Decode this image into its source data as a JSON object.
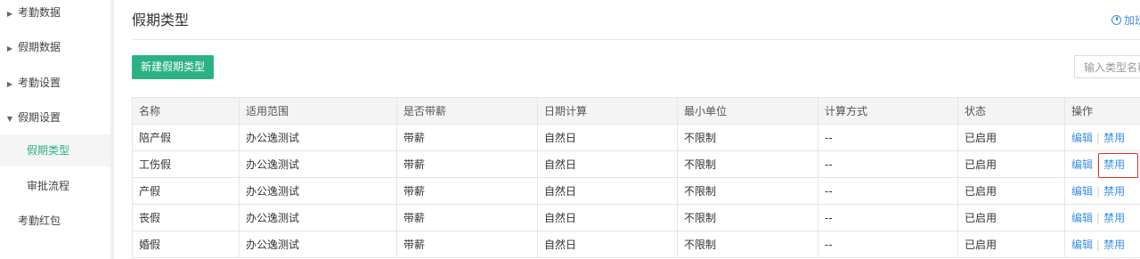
{
  "sidebar": {
    "items": [
      {
        "label": "考勤数据",
        "expandable": true
      },
      {
        "label": "假期数据",
        "expandable": true
      },
      {
        "label": "考勤设置",
        "expandable": true
      },
      {
        "label": "假期设置",
        "expandable": true,
        "expanded": true
      },
      {
        "label": "假期类型",
        "active": true
      },
      {
        "label": "审批流程"
      },
      {
        "label": "考勤红包"
      }
    ]
  },
  "header": {
    "title": "假期类型",
    "link_label": "加班",
    "link_icon": "clock-icon"
  },
  "toolbar": {
    "new_button_label": "新建假期类型",
    "search_placeholder": "输入类型名称"
  },
  "table": {
    "columns": [
      "名称",
      "适用范围",
      "是否带薪",
      "日期计算",
      "最小单位",
      "计算方式",
      "状态",
      "操作"
    ],
    "rows": [
      {
        "name": "陪产假",
        "scope": "办公逸测试",
        "paid": "带薪",
        "date_calc": "自然日",
        "min_unit": "不限制",
        "calc_method": "--",
        "status": "已启用",
        "edit": "编辑",
        "disable": "禁用"
      },
      {
        "name": "工伤假",
        "scope": "办公逸测试",
        "paid": "带薪",
        "date_calc": "自然日",
        "min_unit": "不限制",
        "calc_method": "--",
        "status": "已启用",
        "edit": "编辑",
        "disable": "禁用"
      },
      {
        "name": "产假",
        "scope": "办公逸测试",
        "paid": "带薪",
        "date_calc": "自然日",
        "min_unit": "不限制",
        "calc_method": "--",
        "status": "已启用",
        "edit": "编辑",
        "disable": "禁用"
      },
      {
        "name": "丧假",
        "scope": "办公逸测试",
        "paid": "带薪",
        "date_calc": "自然日",
        "min_unit": "不限制",
        "calc_method": "--",
        "status": "已启用",
        "edit": "编辑",
        "disable": "禁用"
      },
      {
        "name": "婚假",
        "scope": "办公逸测试",
        "paid": "带薪",
        "date_calc": "自然日",
        "min_unit": "不限制",
        "calc_method": "--",
        "status": "已启用",
        "edit": "编辑",
        "disable": "禁用"
      }
    ]
  },
  "colors": {
    "accent": "#2bb282",
    "link": "#3a8ee6",
    "highlight_border": "#e0302a"
  }
}
